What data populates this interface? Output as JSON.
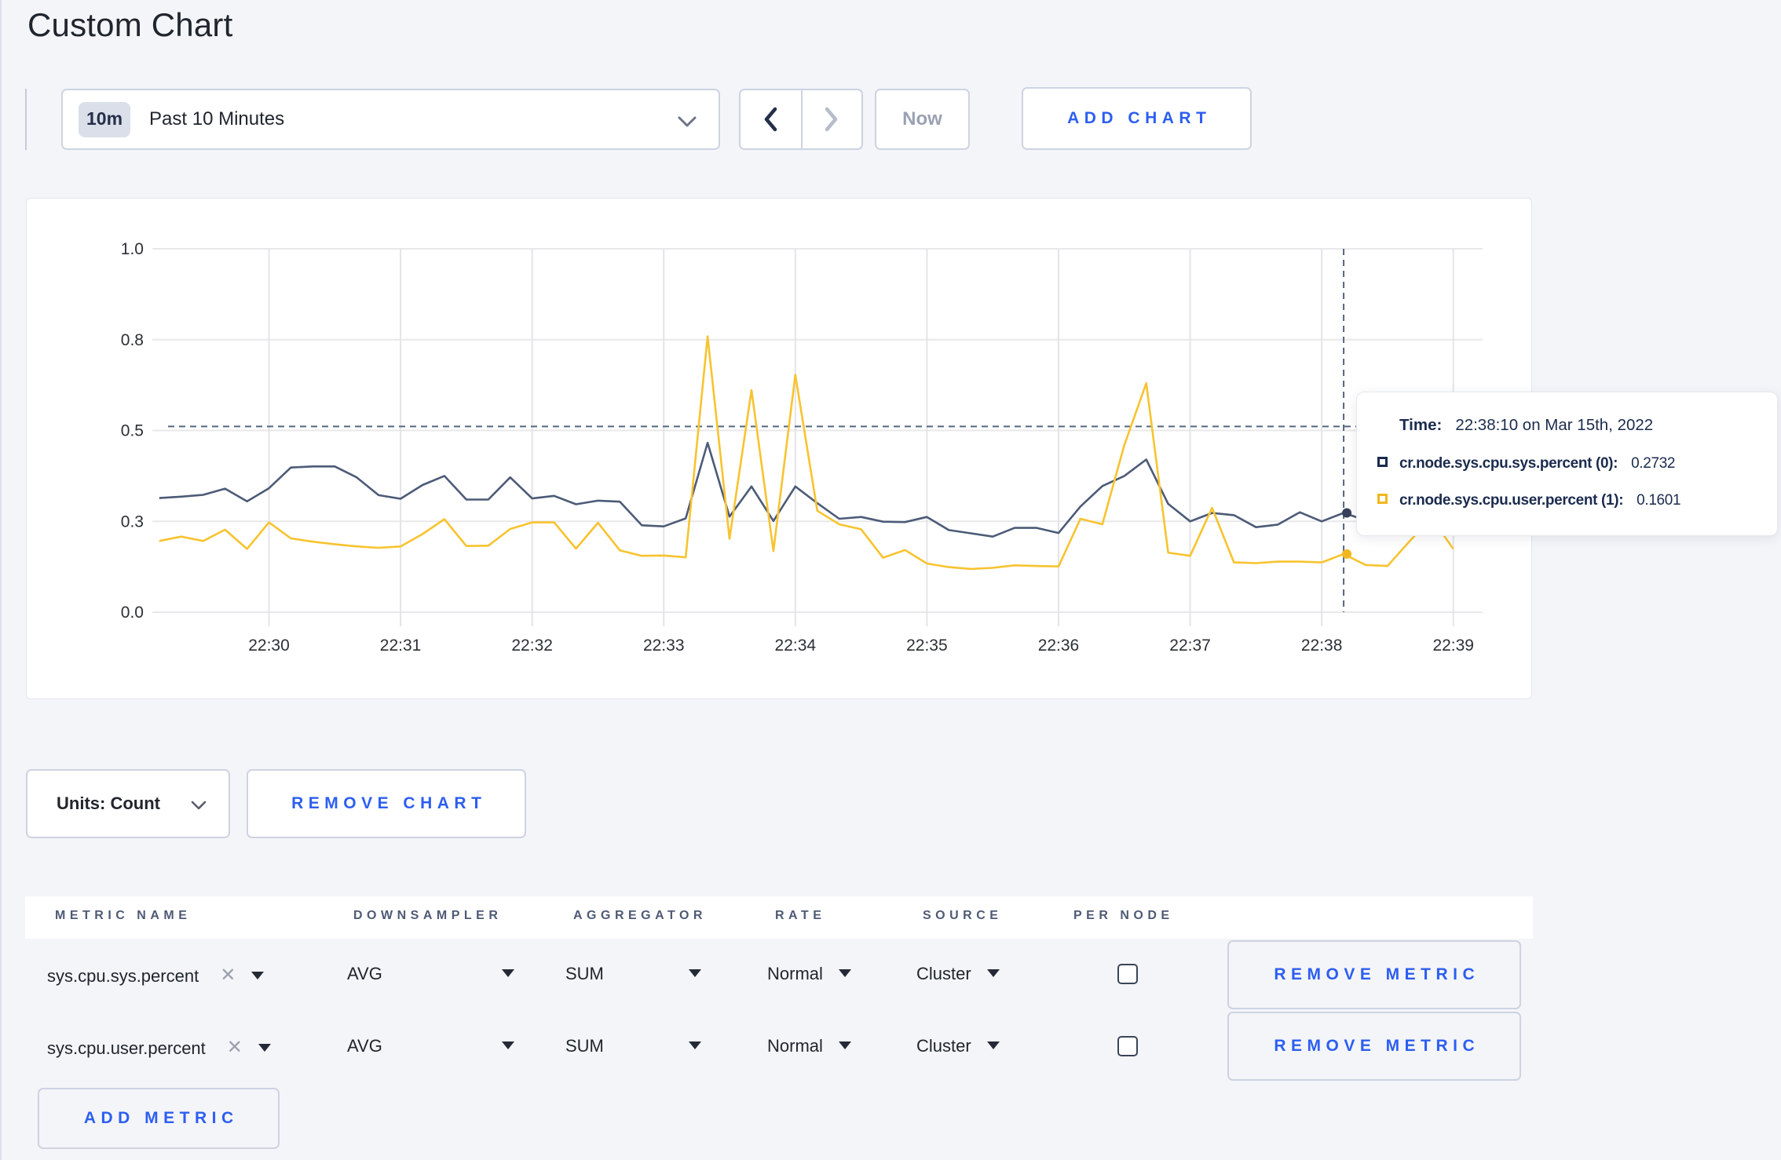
{
  "page": {
    "title": "Custom Chart",
    "background_color": "#f4f5f9",
    "accent_blue": "#2c5ef0"
  },
  "toolbar": {
    "range_badge": "10m",
    "range_label": "Past 10 Minutes",
    "now_label": "Now",
    "add_chart_label": "ADD CHART",
    "icons": {
      "dropdown": "chevron-down",
      "previous": "chevron-left",
      "next": "chevron-right"
    }
  },
  "tooltip": {
    "time_label": "Time:",
    "time_value": "22:38:10 on Mar 15th, 2022",
    "rows": [
      {
        "label": "cr.node.sys.cpu.sys.percent (0):",
        "value": "0.2732",
        "color": "#1b2b4e"
      },
      {
        "label": "cr.node.sys.cpu.user.percent (1):",
        "value": "0.1601",
        "color": "#f2b71e"
      }
    ]
  },
  "units_bar": {
    "units_label": "Units: Count",
    "remove_chart_label": "REMOVE CHART"
  },
  "metrics_table": {
    "headers": [
      "METRIC NAME",
      "DOWNSAMPLER",
      "AGGREGATOR",
      "RATE",
      "SOURCE",
      "PER NODE"
    ],
    "rows": [
      {
        "metric": "sys.cpu.sys.percent",
        "downsampler": "AVG",
        "aggregator": "SUM",
        "rate": "Normal",
        "source": "Cluster",
        "per_node": false,
        "remove_label": "REMOVE METRIC"
      },
      {
        "metric": "sys.cpu.user.percent",
        "downsampler": "AVG",
        "aggregator": "SUM",
        "rate": "Normal",
        "source": "Cluster",
        "per_node": false,
        "remove_label": "REMOVE METRIC"
      }
    ],
    "add_metric_label": "ADD METRIC"
  },
  "chart_data": {
    "type": "line",
    "title": "",
    "xlabel": "",
    "ylabel": "",
    "ylim": [
      0,
      1
    ],
    "grid": true,
    "legend_position": "none",
    "y_ticks": [
      {
        "value": 0.0,
        "label": "0.0"
      },
      {
        "value": 0.25,
        "label": "0.3"
      },
      {
        "value": 0.5,
        "label": "0.5"
      },
      {
        "value": 0.75,
        "label": "0.8"
      },
      {
        "value": 1.0,
        "label": "1.0"
      }
    ],
    "x_ticks": [
      "22:30",
      "22:31",
      "22:32",
      "22:33",
      "22:34",
      "22:35",
      "22:36",
      "22:37",
      "22:38",
      "22:39"
    ],
    "crosshair": {
      "time": "22:38:10",
      "guide_value": 0.511,
      "sys_value": 0.2732,
      "user_value": 0.1601
    },
    "series": [
      {
        "name": "cr.node.sys.cpu.sys.percent",
        "color": "#4c5b77",
        "marker_color": "#37415c",
        "x": [
          "22:29:10",
          "22:29:20",
          "22:29:30",
          "22:29:40",
          "22:29:50",
          "22:30:00",
          "22:30:10",
          "22:30:20",
          "22:30:30",
          "22:30:40",
          "22:30:50",
          "22:31:00",
          "22:31:10",
          "22:31:20",
          "22:31:30",
          "22:31:40",
          "22:31:50",
          "22:32:00",
          "22:32:10",
          "22:32:20",
          "22:32:30",
          "22:32:40",
          "22:32:50",
          "22:33:00",
          "22:33:10",
          "22:33:20",
          "22:33:30",
          "22:33:40",
          "22:33:50",
          "22:34:00",
          "22:34:10",
          "22:34:20",
          "22:34:30",
          "22:34:40",
          "22:34:50",
          "22:35:00",
          "22:35:10",
          "22:35:20",
          "22:35:30",
          "22:35:40",
          "22:35:50",
          "22:36:00",
          "22:36:10",
          "22:36:20",
          "22:36:30",
          "22:36:40",
          "22:36:50",
          "22:37:00",
          "22:37:10",
          "22:37:20",
          "22:37:30",
          "22:37:40",
          "22:37:50",
          "22:38:00",
          "22:38:10",
          "22:38:20",
          "22:38:30",
          "22:38:40",
          "22:38:50",
          "22:39:00"
        ],
        "values": [
          0.314,
          0.318,
          0.323,
          0.34,
          0.305,
          0.341,
          0.398,
          0.401,
          0.401,
          0.371,
          0.322,
          0.312,
          0.35,
          0.375,
          0.31,
          0.31,
          0.371,
          0.313,
          0.32,
          0.297,
          0.307,
          0.304,
          0.239,
          0.236,
          0.258,
          0.466,
          0.263,
          0.346,
          0.251,
          0.346,
          0.3,
          0.257,
          0.262,
          0.249,
          0.248,
          0.262,
          0.226,
          0.217,
          0.208,
          0.232,
          0.232,
          0.218,
          0.291,
          0.347,
          0.375,
          0.42,
          0.298,
          0.25,
          0.273,
          0.267,
          0.234,
          0.241,
          0.275,
          0.25,
          0.2732,
          0.253,
          0.262,
          0.272,
          0.28,
          0.271
        ]
      },
      {
        "name": "cr.node.sys.cpu.user.percent",
        "color": "#f8c32f",
        "marker_color": "#f2b71e",
        "x": [
          "22:29:10",
          "22:29:20",
          "22:29:30",
          "22:29:40",
          "22:29:50",
          "22:30:00",
          "22:30:10",
          "22:30:20",
          "22:30:30",
          "22:30:40",
          "22:30:50",
          "22:31:00",
          "22:31:10",
          "22:31:20",
          "22:31:30",
          "22:31:40",
          "22:31:50",
          "22:32:00",
          "22:32:10",
          "22:32:20",
          "22:32:30",
          "22:32:40",
          "22:32:50",
          "22:33:00",
          "22:33:10",
          "22:33:20",
          "22:33:30",
          "22:33:40",
          "22:33:50",
          "22:34:00",
          "22:34:10",
          "22:34:20",
          "22:34:30",
          "22:34:40",
          "22:34:50",
          "22:35:00",
          "22:35:10",
          "22:35:20",
          "22:35:30",
          "22:35:40",
          "22:35:50",
          "22:36:00",
          "22:36:10",
          "22:36:20",
          "22:36:30",
          "22:36:40",
          "22:36:50",
          "22:37:00",
          "22:37:10",
          "22:37:20",
          "22:37:30",
          "22:37:40",
          "22:37:50",
          "22:38:00",
          "22:38:10",
          "22:38:20",
          "22:38:30",
          "22:38:40",
          "22:38:50",
          "22:39:00"
        ],
        "values": [
          0.196,
          0.208,
          0.196,
          0.227,
          0.174,
          0.247,
          0.203,
          0.194,
          0.187,
          0.181,
          0.177,
          0.181,
          0.215,
          0.256,
          0.182,
          0.183,
          0.229,
          0.247,
          0.247,
          0.175,
          0.246,
          0.17,
          0.155,
          0.156,
          0.151,
          0.759,
          0.202,
          0.611,
          0.168,
          0.653,
          0.279,
          0.242,
          0.228,
          0.15,
          0.171,
          0.134,
          0.124,
          0.119,
          0.122,
          0.129,
          0.127,
          0.126,
          0.257,
          0.242,
          0.46,
          0.63,
          0.164,
          0.155,
          0.287,
          0.137,
          0.135,
          0.139,
          0.139,
          0.137,
          0.1601,
          0.13,
          0.127,
          0.195,
          0.26,
          0.174
        ]
      }
    ]
  }
}
